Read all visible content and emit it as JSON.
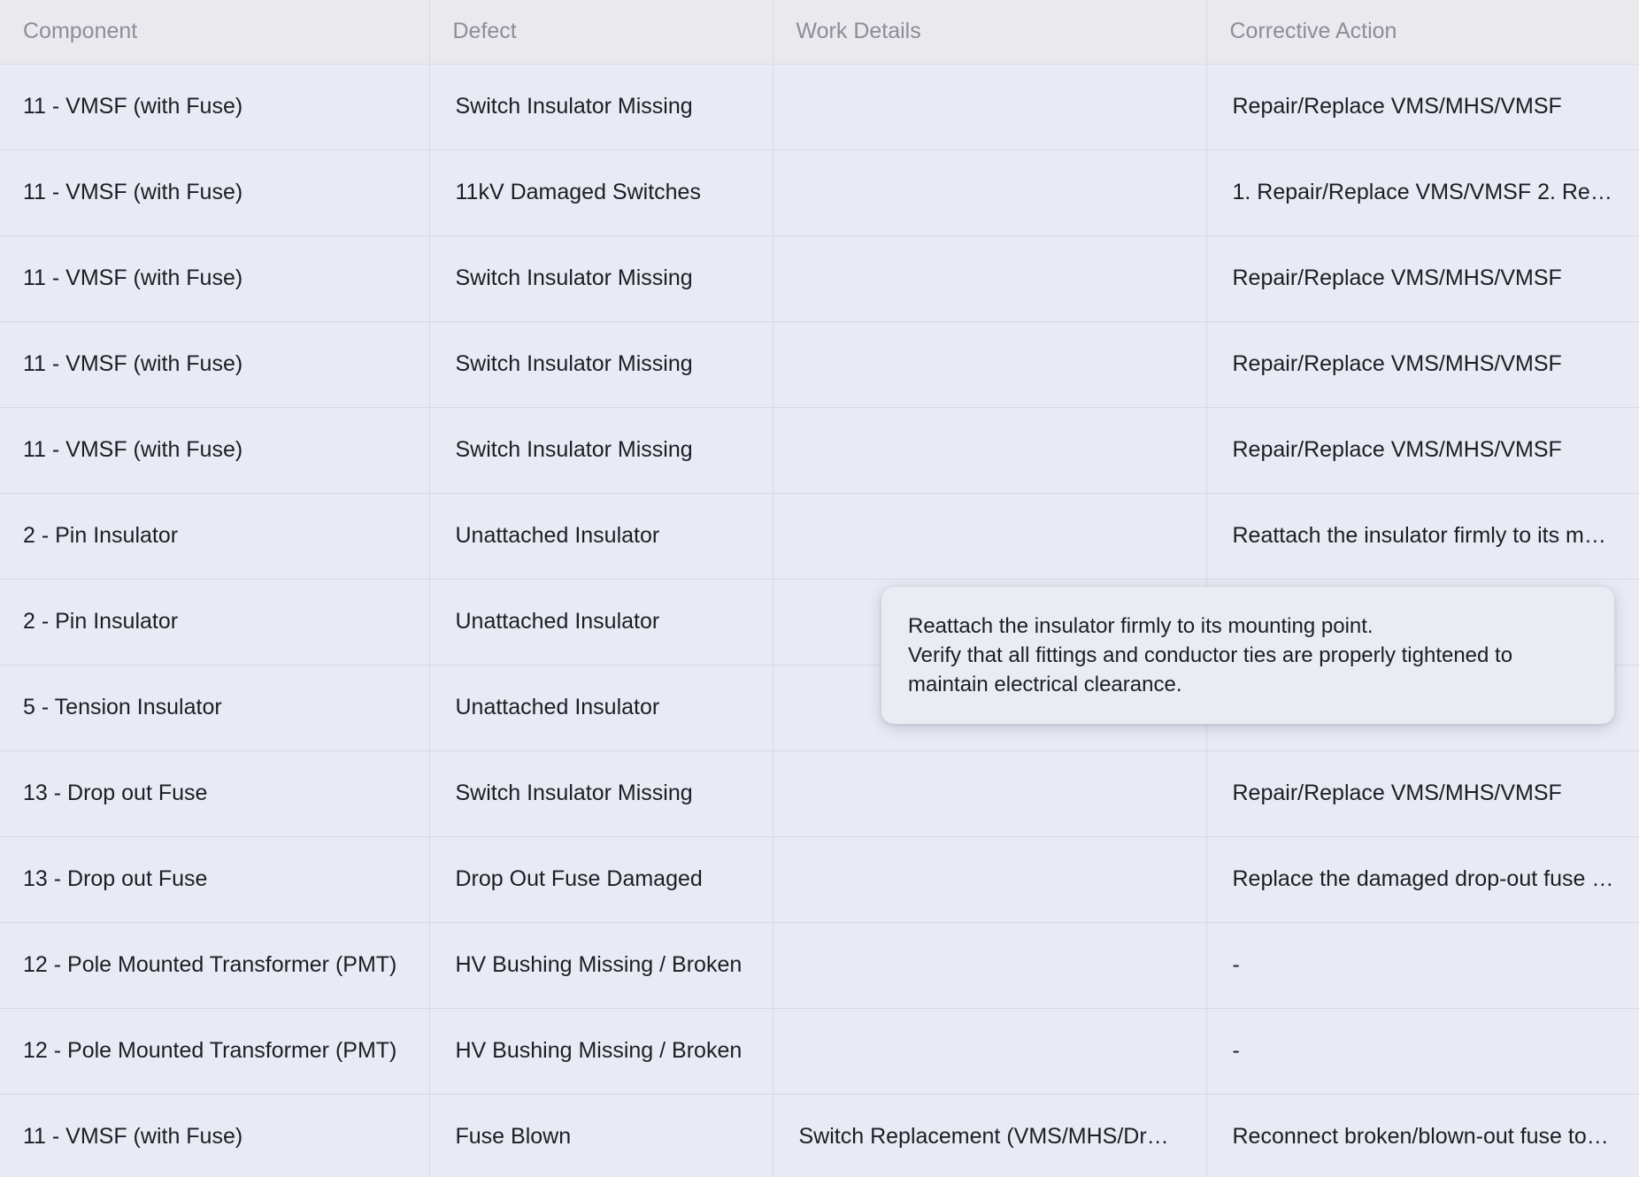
{
  "table": {
    "columns": [
      "Component",
      "Defect",
      "Work Details",
      "Corrective Action"
    ],
    "rows": [
      {
        "component": "11 - VMSF (with Fuse)",
        "defect": "Switch Insulator Missing",
        "work_details": "",
        "corrective_action": "Repair/Replace VMS/MHS/VMSF"
      },
      {
        "component": "11 - VMSF (with Fuse)",
        "defect": "11kV Damaged Switches",
        "work_details": "",
        "corrective_action": "1. Repair/Replace VMS/VMSF 2. Re…"
      },
      {
        "component": "11 - VMSF (with Fuse)",
        "defect": "Switch Insulator Missing",
        "work_details": "",
        "corrective_action": "Repair/Replace VMS/MHS/VMSF"
      },
      {
        "component": "11 - VMSF (with Fuse)",
        "defect": "Switch Insulator Missing",
        "work_details": "",
        "corrective_action": "Repair/Replace VMS/MHS/VMSF"
      },
      {
        "component": "11 - VMSF (with Fuse)",
        "defect": "Switch Insulator Missing",
        "work_details": "",
        "corrective_action": "Repair/Replace VMS/MHS/VMSF"
      },
      {
        "component": "2 - Pin Insulator",
        "defect": "Unattached Insulator",
        "work_details": "",
        "corrective_action": "Reattach the insulator firmly to its m…"
      },
      {
        "component": "2 - Pin Insulator",
        "defect": "Unattached Insulator",
        "work_details": "",
        "corrective_action": ""
      },
      {
        "component": "5 - Tension Insulator",
        "defect": "Unattached Insulator",
        "work_details": "",
        "corrective_action": ""
      },
      {
        "component": "13 - Drop out Fuse",
        "defect": "Switch Insulator Missing",
        "work_details": "",
        "corrective_action": "Repair/Replace VMS/MHS/VMSF"
      },
      {
        "component": "13 - Drop out Fuse",
        "defect": "Drop Out Fuse Damaged",
        "work_details": "",
        "corrective_action": "Replace the damaged drop-out fuse …"
      },
      {
        "component": "12 - Pole Mounted Transformer (PMT)",
        "defect": "HV Bushing Missing / Broken",
        "work_details": "",
        "corrective_action": "-"
      },
      {
        "component": "12 - Pole Mounted Transformer (PMT)",
        "defect": "HV Bushing Missing / Broken",
        "work_details": "",
        "corrective_action": "-"
      },
      {
        "component": "11 - VMSF (with Fuse)",
        "defect": "Fuse Blown",
        "work_details": "Switch Replacement (VMS/MHS/Dro…",
        "corrective_action": "Reconnect broken/blown-out fuse to…"
      }
    ]
  },
  "tooltip": {
    "line1": "Reattach the insulator firmly to its mounting point.",
    "line2": "Verify that all fittings and conductor ties are properly tightened to maintain electrical clearance."
  }
}
